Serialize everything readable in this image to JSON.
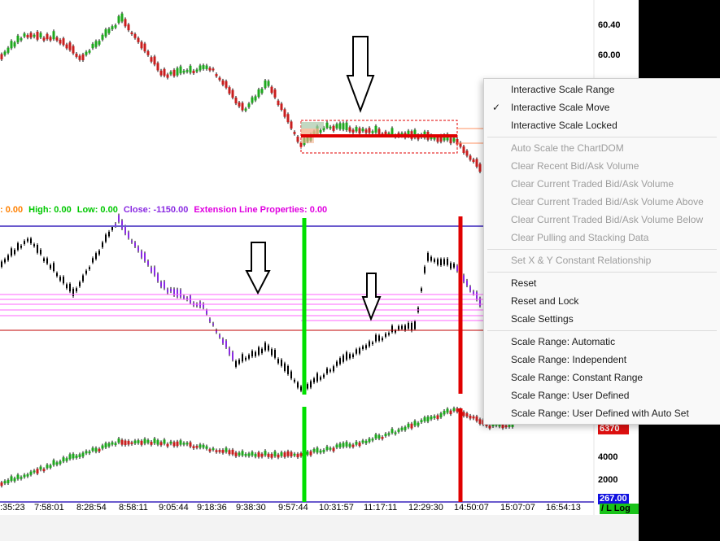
{
  "price_scale": {
    "labels": [
      "60.40",
      "60.00"
    ],
    "bottom_labels": [
      "4000",
      "2000"
    ],
    "badge_red": "6370",
    "badge_blue": "267.00",
    "log_button": "/ L Log"
  },
  "study_legend": [
    {
      "text": ": 0.00",
      "color": "#ff8000"
    },
    {
      "text": "High: 0.00",
      "color": "#00c800"
    },
    {
      "text": "Low: 0.00",
      "color": "#00c800"
    },
    {
      "text": "Close: -1150.00",
      "color": "#8a2be2"
    },
    {
      "text": "Extension Line Properties: 0.00",
      "color": "#e000e0"
    }
  ],
  "time_axis": [
    ":35:23",
    "7:58:01",
    "8:28:54",
    "8:58:11",
    "9:05:44",
    "9:18:36",
    "9:38:30",
    "9:57:44",
    "10:31:57",
    "11:17:11",
    "12:29:30",
    "14:50:07",
    "15:07:07",
    "16:54:13"
  ],
  "context_menu": {
    "groups": [
      [
        {
          "label": "Interactive Scale Range",
          "enabled": true,
          "checked": false
        },
        {
          "label": "Interactive Scale Move",
          "enabled": true,
          "checked": true
        },
        {
          "label": "Interactive Scale Locked",
          "enabled": true,
          "checked": false
        }
      ],
      [
        {
          "label": "Auto Scale the ChartDOM",
          "enabled": false
        },
        {
          "label": "Clear Recent Bid/Ask Volume",
          "enabled": false
        },
        {
          "label": "Clear Current Traded Bid/Ask Volume",
          "enabled": false
        },
        {
          "label": "Clear Current Traded Bid/Ask Volume Above",
          "enabled": false
        },
        {
          "label": "Clear Current Traded Bid/Ask Volume Below",
          "enabled": false
        },
        {
          "label": "Clear Pulling and Stacking Data",
          "enabled": false
        }
      ],
      [
        {
          "label": "Set X & Y Constant Relationship",
          "enabled": false
        }
      ],
      [
        {
          "label": "Reset",
          "enabled": true
        },
        {
          "label": "Reset and Lock",
          "enabled": true
        },
        {
          "label": "Scale Settings",
          "enabled": true
        }
      ],
      [
        {
          "label": "Scale Range: Automatic",
          "enabled": true
        },
        {
          "label": "Scale Range: Independent",
          "enabled": true
        },
        {
          "label": "Scale Range: Constant Range",
          "enabled": true
        },
        {
          "label": "Scale Range: User Defined",
          "enabled": true
        },
        {
          "label": "Scale Range: User Defined with Auto Set",
          "enabled": true
        }
      ]
    ]
  },
  "colors": {
    "up_candle": "#1fa81f",
    "down_candle": "#c81e1e",
    "study_purple": "#8a2be2",
    "marker_green": "#00e000",
    "marker_red": "#e00000",
    "level_magenta": "#ff66ff",
    "top_line_blue": "#6a5acd"
  }
}
